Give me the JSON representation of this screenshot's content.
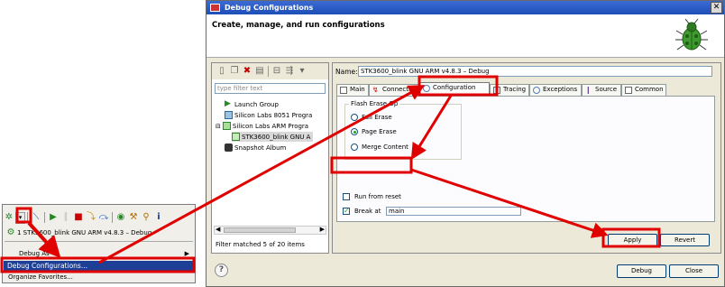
{
  "toolbar_panel": {
    "launch_item_label": "1 STK3600_blink GNU ARM v4.8.3 – Debug",
    "menu": {
      "debug_as": "Debug As",
      "debug_configurations": "Debug Configurations...",
      "organize_favorites": "Organize Favorites..."
    }
  },
  "dialog": {
    "title": "Debug Configurations",
    "header": "Create, manage, and run configurations",
    "filter_placeholder": "type filter text",
    "tree": [
      {
        "label": "Launch Group",
        "icon": "launch-group-icon"
      },
      {
        "label": "Silicon Labs 8051 Progra",
        "icon": "chip-icon"
      },
      {
        "label": "Silicon Labs ARM Progra",
        "icon": "chip-icon"
      },
      {
        "label": "STK3600_blink GNU A",
        "icon": "chip-icon"
      },
      {
        "label": "Snapshot Album",
        "icon": "camera-icon"
      }
    ],
    "filter_status": "Filter matched 5 of 20 items",
    "name_label": "Name:",
    "name_value": "STK3600_blink GNU ARM v4.8.3 – Debug",
    "tabs": [
      {
        "label": "Main",
        "icon": "main-tab-icon"
      },
      {
        "label": "Connectio",
        "icon": "connection-icon"
      },
      {
        "label": "Configuration",
        "icon": "configuration-icon"
      },
      {
        "label": "Tracing",
        "icon": "tracing-icon"
      },
      {
        "label": "Exceptions",
        "icon": "exceptions-icon"
      },
      {
        "label": "Source",
        "icon": "source-icon"
      },
      {
        "label": "Common",
        "icon": "common-icon"
      }
    ],
    "flash_erase": {
      "legend": "Flash Erase Op",
      "options": [
        {
          "label": "Full Erase",
          "selected": false
        },
        {
          "label": "Page Erase",
          "selected": true
        },
        {
          "label": "Merge Content",
          "selected": false
        }
      ]
    },
    "run_from_reset": {
      "label": "Run from reset",
      "checked": false
    },
    "break_at": {
      "label": "Break at",
      "checked": true,
      "value": "main"
    },
    "buttons": {
      "apply": "Apply",
      "revert": "Revert",
      "debug": "Debug",
      "close": "Close",
      "help": "?"
    }
  },
  "colors": {
    "highlight_box": "#e00000",
    "menu_selection": "#1e3f96",
    "titlebar": "#2a5cc8"
  }
}
